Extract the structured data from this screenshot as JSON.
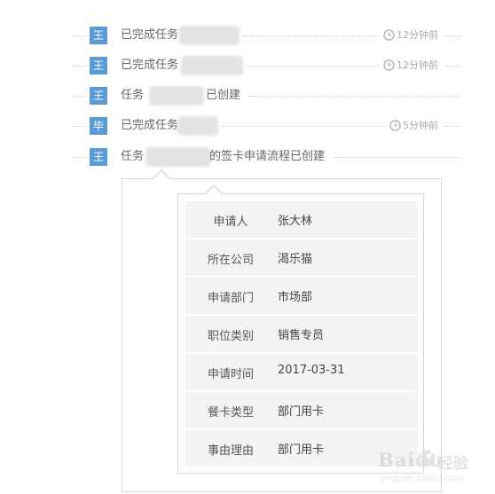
{
  "feed": [
    {
      "avatar": "王",
      "text": "已完成任务",
      "suffix": "",
      "time": "12分钟前"
    },
    {
      "avatar": "王",
      "text": "已完成任务",
      "suffix": "",
      "time": "12分钟前"
    },
    {
      "avatar": "王",
      "text": "任务",
      "suffix": "已创建",
      "time": ""
    },
    {
      "avatar": "毕",
      "text": "已完成任务",
      "suffix": "",
      "time": "5分钟前"
    },
    {
      "avatar": "王",
      "text": "任务",
      "suffix": "的签卡申请流程已创建",
      "time": ""
    }
  ],
  "detail": [
    {
      "label": "申请人",
      "value": "张大林"
    },
    {
      "label": "所在公司",
      "value": "渴乐猫"
    },
    {
      "label": "申请部门",
      "value": "市场部"
    },
    {
      "label": "职位类别",
      "value": "销售专员"
    },
    {
      "label": "申请时间",
      "value": "2017-03-31"
    },
    {
      "label": "餐卡类型",
      "value": "部门用卡"
    },
    {
      "label": "事由理由",
      "value": "部门用卡"
    }
  ],
  "watermark": {
    "brand": "Baidu",
    "sub": "经验",
    "url": "jingyan.baidu.com"
  },
  "colors": {
    "avatar": "#5b9bd5",
    "time": "#aaaaaa"
  }
}
